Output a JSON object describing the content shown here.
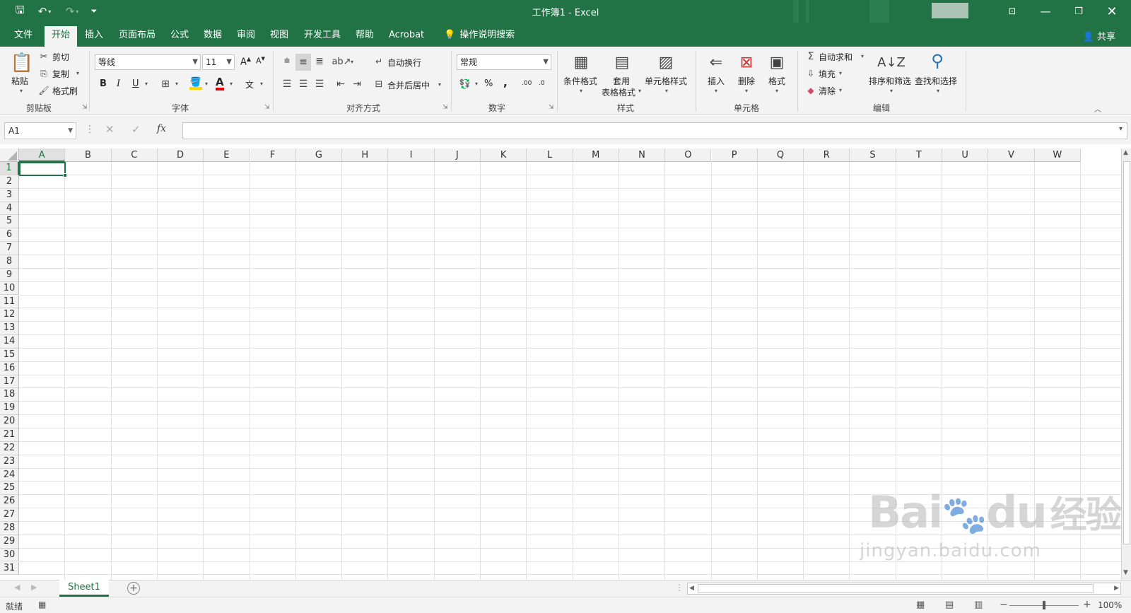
{
  "app": {
    "window_title": "工作簿1  -  Excel",
    "accent_color": "#217346"
  },
  "tabs": [
    "文件",
    "开始",
    "插入",
    "页面布局",
    "公式",
    "数据",
    "审阅",
    "视图",
    "开发工具",
    "帮助",
    "Acrobat"
  ],
  "active_tab": "开始",
  "tell_me": "操作说明搜索",
  "share": "共享",
  "ribbon": {
    "clipboard": {
      "label": "剪贴板",
      "paste": "粘贴",
      "cut": "剪切",
      "copy": "复制",
      "format_painter": "格式刷"
    },
    "font": {
      "label": "字体",
      "font_name": "等线",
      "font_size": "11",
      "grow": "A",
      "shrink": "A",
      "bold": "B",
      "italic": "I",
      "underline": "U",
      "font_color": "A",
      "phonetic": "文"
    },
    "alignment": {
      "label": "对齐方式",
      "wrap_text": "自动换行",
      "merge_center": "合并后居中"
    },
    "number": {
      "label": "数字",
      "format": "常规",
      "percent": "%",
      "comma": ",",
      "inc_decimal": ".00",
      "dec_decimal": ".0"
    },
    "styles": {
      "label": "样式",
      "conditional": "条件格式",
      "table_format_1": "套用",
      "table_format_2": "表格格式",
      "cell_styles": "单元格样式"
    },
    "cells": {
      "label": "单元格",
      "insert": "插入",
      "delete": "删除",
      "format": "格式"
    },
    "editing": {
      "label": "编辑",
      "autosum": "自动求和",
      "fill": "填充",
      "clear": "清除",
      "sort_filter": "排序和筛选",
      "find_select": "查找和选择"
    }
  },
  "formula_bar": {
    "name_box": "A1",
    "fx": "fx",
    "formula": ""
  },
  "columns": [
    "A",
    "B",
    "C",
    "D",
    "E",
    "F",
    "G",
    "H",
    "I",
    "J",
    "K",
    "L",
    "M",
    "N",
    "O",
    "P",
    "Q",
    "R",
    "S",
    "T",
    "U",
    "V",
    "W"
  ],
  "rows": [
    "1",
    "2",
    "3",
    "4",
    "5",
    "6",
    "7",
    "8",
    "9",
    "10",
    "11",
    "12",
    "13",
    "14",
    "15",
    "16",
    "17",
    "18",
    "19",
    "20",
    "21",
    "22",
    "23",
    "24",
    "25",
    "26",
    "27",
    "28",
    "29",
    "30",
    "31"
  ],
  "active_cell": "A1",
  "sheets": [
    "Sheet1"
  ],
  "status": {
    "ready": "就绪",
    "zoom": "100%"
  },
  "watermark": {
    "line1": "Bai",
    "line2": "du",
    "line3": "经验",
    "url": "jingyan.baidu.com"
  }
}
